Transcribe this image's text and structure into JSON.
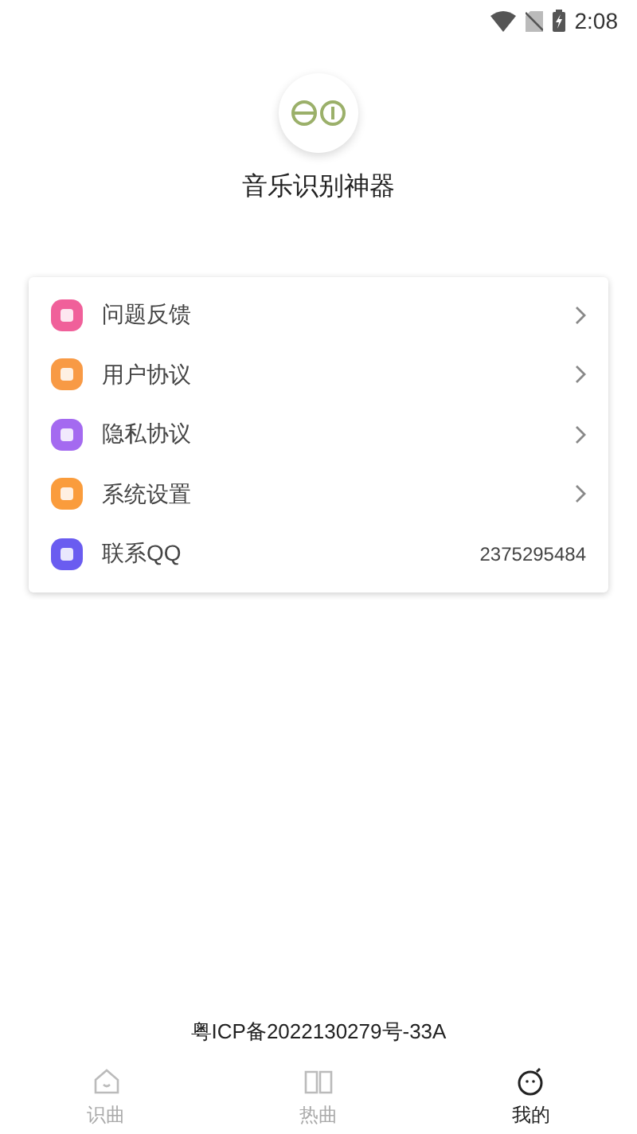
{
  "status_bar": {
    "time": "2:08"
  },
  "app": {
    "name": "音乐识别神器"
  },
  "menu": [
    {
      "label": "问题反馈",
      "kind": "arrow",
      "color": "#f0609a"
    },
    {
      "label": "用户协议",
      "kind": "arrow",
      "color": "#f89a45"
    },
    {
      "label": "隐私协议",
      "kind": "arrow",
      "color": "#a46af0"
    },
    {
      "label": "系统设置",
      "kind": "arrow",
      "color": "#fa9c3c"
    },
    {
      "label": "联系QQ",
      "kind": "value",
      "value": "2375295484",
      "color": "#6a5cf0"
    }
  ],
  "footer": {
    "text": "粤ICP备2022130279号-33A"
  },
  "tabs": [
    {
      "label": "识曲",
      "selected": false
    },
    {
      "label": "热曲",
      "selected": false
    },
    {
      "label": "我的",
      "selected": true
    }
  ]
}
